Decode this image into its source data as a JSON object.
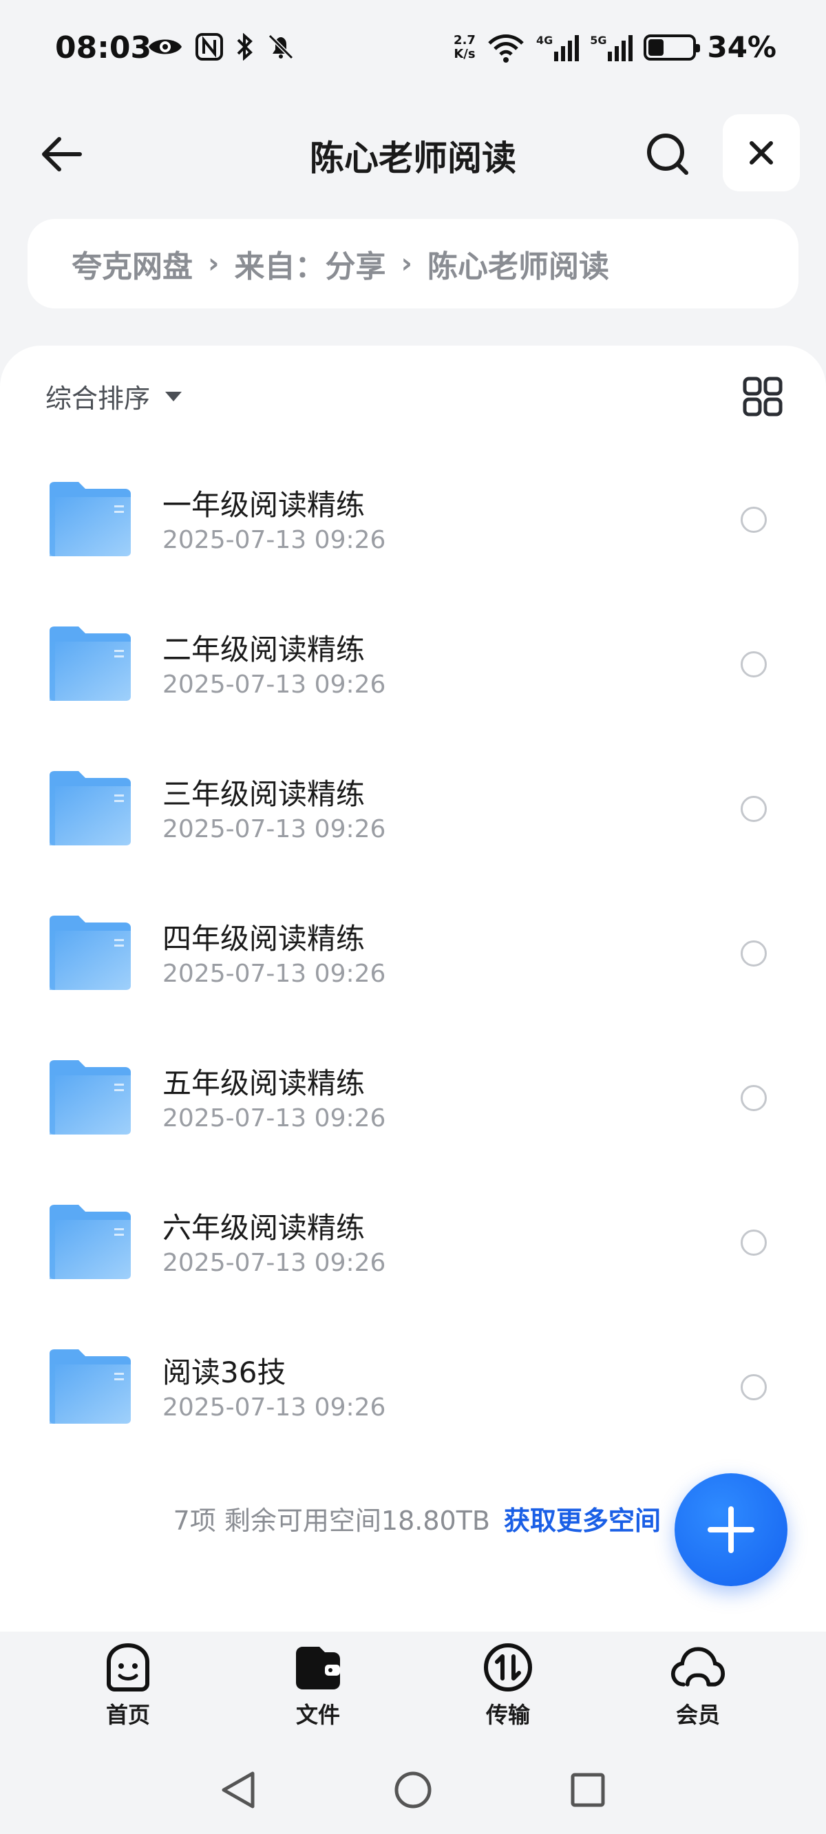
{
  "status_bar": {
    "time": "08:03",
    "net_speed_value": "2.7",
    "net_speed_unit": "K/s",
    "net_4g": "4G",
    "net_5g": "5G",
    "battery": "34%",
    "battery_level": 0.34
  },
  "header": {
    "title": "陈心老师阅读"
  },
  "breadcrumb": {
    "items": [
      "夸克网盘",
      "来自：分享",
      "陈心老师阅读"
    ],
    "separator": "›"
  },
  "sort": {
    "label": "综合排序"
  },
  "files": [
    {
      "name": "一年级阅读精练",
      "date": "2025-07-13 09:26"
    },
    {
      "name": "二年级阅读精练",
      "date": "2025-07-13 09:26"
    },
    {
      "name": "三年级阅读精练",
      "date": "2025-07-13 09:26"
    },
    {
      "name": "四年级阅读精练",
      "date": "2025-07-13 09:26"
    },
    {
      "name": "五年级阅读精练",
      "date": "2025-07-13 09:26"
    },
    {
      "name": "六年级阅读精练",
      "date": "2025-07-13 09:26"
    },
    {
      "name": "阅读36技",
      "date": "2025-07-13 09:26"
    }
  ],
  "summary": {
    "count_text": "7项 剩余可用空间18.80TB",
    "link_text": "获取更多空间"
  },
  "bottom_nav": {
    "items": [
      {
        "label": "首页",
        "icon": "smile-home-icon"
      },
      {
        "label": "文件",
        "icon": "wallet-folder-icon"
      },
      {
        "label": "传输",
        "icon": "transfer-icon"
      },
      {
        "label": "会员",
        "icon": "cloud-icon"
      }
    ]
  },
  "colors": {
    "accent": "#1a5fe6",
    "fab": "#1462f0",
    "folder": "#5aa9f5"
  }
}
